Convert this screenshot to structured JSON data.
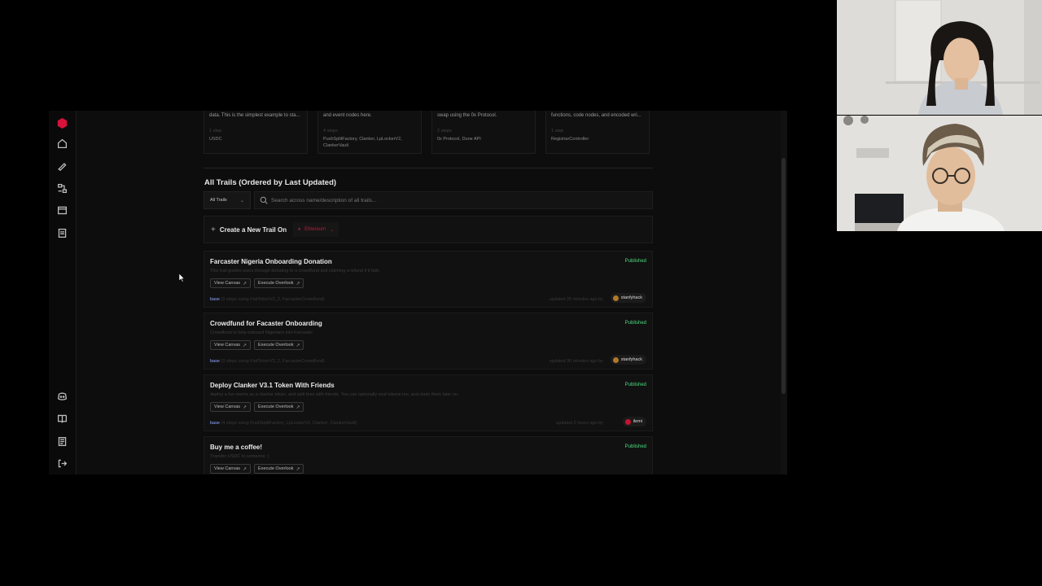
{
  "sidebar": {
    "icons": [
      "logo-icon",
      "home-icon",
      "pen-icon",
      "flow-icon",
      "window-icon",
      "document-icon",
      "discord-icon",
      "book-icon",
      "notes-icon",
      "logout-icon"
    ]
  },
  "cards": [
    {
      "desc": "data. This is the simplest example to sta...",
      "steps": "1 step",
      "contracts": "USDC"
    },
    {
      "desc": "and event nodes here.",
      "steps": "4 steps",
      "contracts": "PushSplitFactory, Clanker, LpLockerV2, ClankerVault"
    },
    {
      "desc": "swap using the 0x Protocol.",
      "steps": "2 steps",
      "contracts": "0x Protocol, Dune API"
    },
    {
      "desc": "functions, code nodes, and encoded wri...",
      "steps": "1 step",
      "contracts": "RegistrarController"
    }
  ],
  "section": {
    "title": "All Trails (Ordered by Last Updated)"
  },
  "filter": {
    "label": "All Trails"
  },
  "search": {
    "placeholder": "Search across name/description of all trails..."
  },
  "create": {
    "label": "Create a New Trail On",
    "chain": "Ethereum"
  },
  "actions": {
    "view_canvas": "View Canvas",
    "execute_overlook": "Execute Overlook"
  },
  "trails": [
    {
      "title": "Farcaster Nigeria Onboarding Donation",
      "status": "Published",
      "desc": "This trail guides users through donating to a crowdfund and claiming a refund if it fails",
      "network": "base",
      "meta": "(3 steps using FiatTokenV2_2, FarcasterCrowdfund)",
      "updated": "updated 26 minutes ago by",
      "author": "stanfyhack"
    },
    {
      "title": "Crowdfund for Facaster Onboarding",
      "status": "Published",
      "desc": "Crowdfund to help onboard Nigerians into Farcaster",
      "network": "base",
      "meta": "(3 steps using FiatTokenV2_2, FarcasterCrowdfund)",
      "updated": "updated 30 minutes ago by",
      "author": "stanfyhack"
    },
    {
      "title": "Deploy Clanker V3.1 Token With Friends",
      "status": "Published",
      "desc": "deploy a fun meme as a clanker token, and split fees with friends. You can optionally vest tokens too, and claim them later on.",
      "network": "base",
      "meta": "(4 steps using PushSplitFactory, LpLockerV2, Clanker, ClankerVault)",
      "updated": "updated 2 hours ago by",
      "author": "ilemi"
    },
    {
      "title": "Buy me a coffee!",
      "status": "Published",
      "desc": "Transfer USDC to someone :)",
      "network": "",
      "meta": "",
      "updated": "",
      "author": ""
    }
  ]
}
